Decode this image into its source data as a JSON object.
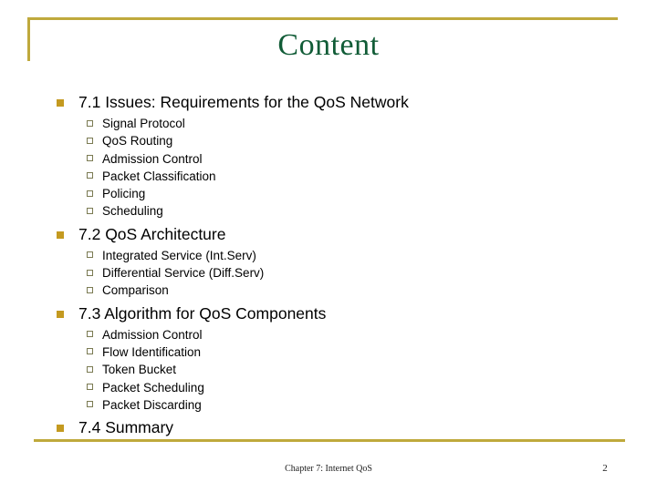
{
  "slide": {
    "title": "Content",
    "title_color": "#115c37",
    "accent_color": "#bfa93c",
    "bullet1_color": "#c49a20",
    "background": "#ffffff"
  },
  "sections": [
    {
      "heading": "7.1 Issues: Requirements for the QoS Network",
      "items": [
        "Signal Protocol",
        "QoS Routing",
        "Admission Control",
        "Packet Classification",
        "Policing",
        "Scheduling"
      ]
    },
    {
      "heading": "7.2 QoS Architecture",
      "items": [
        "Integrated Service (Int.Serv)",
        "Differential Service (Diff.Serv)",
        "Comparison"
      ]
    },
    {
      "heading": "7.3 Algorithm for QoS Components",
      "items": [
        "Admission Control",
        "Flow Identification",
        "Token Bucket",
        "Packet Scheduling",
        "Packet Discarding"
      ]
    },
    {
      "heading": "7.4 Summary",
      "items": []
    }
  ],
  "footer": {
    "center_text": "Chapter 7: Internet QoS",
    "page_number": "2"
  }
}
